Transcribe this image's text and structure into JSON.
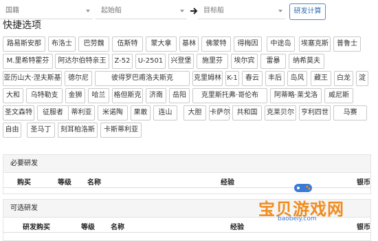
{
  "toolbar": {
    "nation_placeholder": "国籍",
    "start_ship_placeholder": "起始船",
    "target_ship_placeholder": "目标船",
    "calc_button_label": "研发计算"
  },
  "quick_options": {
    "title": "快捷选项",
    "chips": [
      "路易斯安那",
      "布洛士",
      "巴劳魏",
      "伍斯特",
      "蒙大拿",
      "基林",
      "佛蒙特",
      "得梅因",
      "中途岛",
      "埃塞克斯",
      "普鲁士",
      "M.里希特霍芬",
      "阿达尔伯特亲王",
      "Z-52",
      "U-2501",
      "兴登堡",
      "施里芬",
      "埃尔宾",
      "雷暴",
      "纳希莫夫",
      "亚历山大·涅夫斯基",
      "德尔尼",
      "彼得罗巴甫洛夫斯克",
      "克里姆林",
      "K-1",
      "春云",
      "丰后",
      "岛风",
      "藏王",
      "白龙",
      "淀",
      "大和",
      "乌特勒支",
      "金狮",
      "哈兰",
      "格但斯克",
      "济南",
      "岳阳",
      "克里斯托弗·哥伦布",
      "阿蒂略·莱戈洛",
      "威尼斯",
      "圣文森特",
      "征服者",
      "蒂利亚",
      "米诺陶",
      "果敢",
      "连山",
      "大胆",
      "卡萨尔",
      "共和国",
      "克莱贝尔",
      "亨利四世",
      "马赛",
      "自由",
      "圣马丁",
      "刻耳柏洛斯",
      "卡斯蒂利亚"
    ]
  },
  "required_panel": {
    "title": "必要研发",
    "columns": [
      "购买",
      "等级",
      "名称",
      "经验",
      "银币"
    ]
  },
  "optional_panel": {
    "title": "可选研发",
    "columns": [
      "研发购买",
      "等级",
      "名称",
      "经验",
      "银币"
    ]
  },
  "watermark": {
    "title": "宝贝游戏网",
    "url": "baobeiy.com"
  },
  "colors": {
    "accent": "#4a8ec8",
    "watermark_orange": "#f08c1e",
    "watermark_blue": "#3a7bd5"
  }
}
